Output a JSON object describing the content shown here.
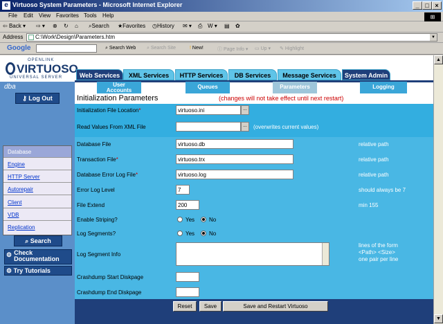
{
  "window": {
    "title": "Virtuoso System Parameters - Microsoft Internet Explorer"
  },
  "menu": [
    "File",
    "Edit",
    "View",
    "Favorites",
    "Tools",
    "Help"
  ],
  "toolbar": {
    "back": "Back",
    "search": "Search",
    "favorites": "Favorites",
    "history": "History"
  },
  "address": {
    "label": "Address",
    "value": "C:\\Work\\Design\\Parameters.htm"
  },
  "google": {
    "logo": "Google",
    "search_web": "Search Web",
    "search_site": "Search Site",
    "new": "New!",
    "page_info": "Page Info",
    "up": "Up",
    "highlight": "Highlight"
  },
  "logo": {
    "openlink": "OPENLINK",
    "virtuoso": "VIRTUOSO",
    "universal": "UNIVERSAL SERVER"
  },
  "sidebar": {
    "dba": "dba",
    "logout": "Log Out",
    "nav": [
      {
        "label": "Database",
        "active": true
      },
      {
        "label": "Engine"
      },
      {
        "label": "HTTP Server"
      },
      {
        "label": "Autorepair"
      },
      {
        "label": "Client"
      },
      {
        "label": "VDB"
      },
      {
        "label": "Replication"
      }
    ],
    "search": "Search",
    "check_doc_1": "Check",
    "check_doc_2": "Documentation",
    "try_tutorials": "Try Tutorials"
  },
  "tabs": [
    "Web Services",
    "XML Services",
    "HTTP Services",
    "DB Services",
    "Message Services",
    "System Admin"
  ],
  "subtabs": [
    [
      "User",
      "Accounts"
    ],
    [
      "Queues"
    ],
    [
      "Parameters"
    ],
    [
      "Logging"
    ]
  ],
  "form": {
    "heading": "Initialization Parameters",
    "notice": "(changes will not take effect until next restart)",
    "init_file_label": "Initialization File Location",
    "init_file_value": "virtuoso.ini",
    "read_xml_label": "Read Values From XML File",
    "read_xml_hint": "(overwrites current values)",
    "database_file_label": "Database File",
    "database_file_value": "virtuoso.db",
    "database_file_hint": "relative path",
    "transaction_file_label": "Transaction File",
    "transaction_file_value": "virtuoso.trx",
    "transaction_file_hint": "relative path",
    "error_log_file_label": "Database Error Log File",
    "error_log_file_value": "virtuoso.log",
    "error_log_file_hint": "relative path",
    "error_log_level_label": "Error Log Level",
    "error_log_level_value": "7",
    "error_log_level_hint": "should always be 7",
    "file_extend_label": "File Extend",
    "file_extend_value": "200",
    "file_extend_hint": "min 155",
    "striping_label": "Enable Striping?",
    "log_segments_label": "Log Segments?",
    "yes": "Yes",
    "no": "No",
    "log_segment_info_label": "Log Segment Info",
    "log_segment_hint_1": "lines of the form",
    "log_segment_hint_2": "<Path> <Size>",
    "log_segment_hint_3": "one pair per line",
    "crash_start_label": "Crashdump Start Diskpage",
    "crash_end_label": "Crashdump End Diskpage",
    "required_mark": "*",
    "ellipsis": "..."
  },
  "buttons": {
    "reset": "Reset",
    "save": "Save",
    "save_restart": "Save and Restart Virtuoso"
  },
  "colors": {
    "panel": "#33aee0",
    "navy": "#1f3f7a",
    "sidebar": "#5b8fc9",
    "required": "#cc0000"
  }
}
